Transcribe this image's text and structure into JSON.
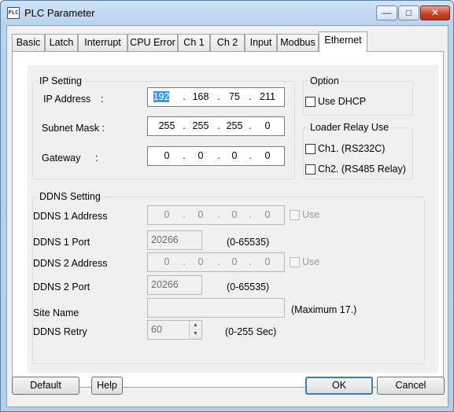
{
  "window": {
    "title": "PLC Parameter",
    "icon_text": "PLC",
    "controls": {
      "minimize": "—",
      "maximize": "□",
      "close": "✕"
    }
  },
  "tabs": [
    "Basic",
    "Latch",
    "Interrupt",
    "CPU Error",
    "Ch 1",
    "Ch 2",
    "Input",
    "Modbus",
    "Ethernet"
  ],
  "active_tab": "Ethernet",
  "ip_setting": {
    "title": "IP Setting",
    "ip_address": {
      "label": "IP Address",
      "colon": ":",
      "octets": [
        "192",
        "168",
        "75",
        "211"
      ]
    },
    "subnet_mask": {
      "label": "Subnet Mask :",
      "octets": [
        "255",
        "255",
        "255",
        "0"
      ]
    },
    "gateway": {
      "label": "Gateway",
      "colon": ":",
      "octets": [
        "0",
        "0",
        "0",
        "0"
      ]
    }
  },
  "option": {
    "title": "Option",
    "use_dhcp": {
      "label": "Use DHCP",
      "checked": false
    }
  },
  "loader_relay": {
    "title": "Loader Relay Use",
    "ch1": {
      "label": "Ch1. (RS232C)",
      "checked": false
    },
    "ch2": {
      "label": "Ch2. (RS485 Relay)",
      "checked": false
    }
  },
  "ddns": {
    "title": "DDNS Setting",
    "ddns1_address": {
      "label": "DDNS 1 Address",
      "octets": [
        "0",
        "0",
        "0",
        "0"
      ],
      "use_label": "Use"
    },
    "ddns1_port": {
      "label": "DDNS 1 Port",
      "value": "20266",
      "range": "(0-65535)"
    },
    "ddns2_address": {
      "label": "DDNS 2 Address",
      "octets": [
        "0",
        "0",
        "0",
        "0"
      ],
      "use_label": "Use"
    },
    "ddns2_port": {
      "label": "DDNS 2 Port",
      "value": "20266",
      "range": "(0-65535)"
    },
    "site_name": {
      "label": "Site Name",
      "value": "",
      "hint": "(Maximum 17.)"
    },
    "retry": {
      "label": "DDNS Retry",
      "value": "60",
      "range": "(0-255 Sec)"
    }
  },
  "buttons": {
    "default": "Default",
    "help": "Help",
    "ok": "OK",
    "cancel": "Cancel"
  }
}
